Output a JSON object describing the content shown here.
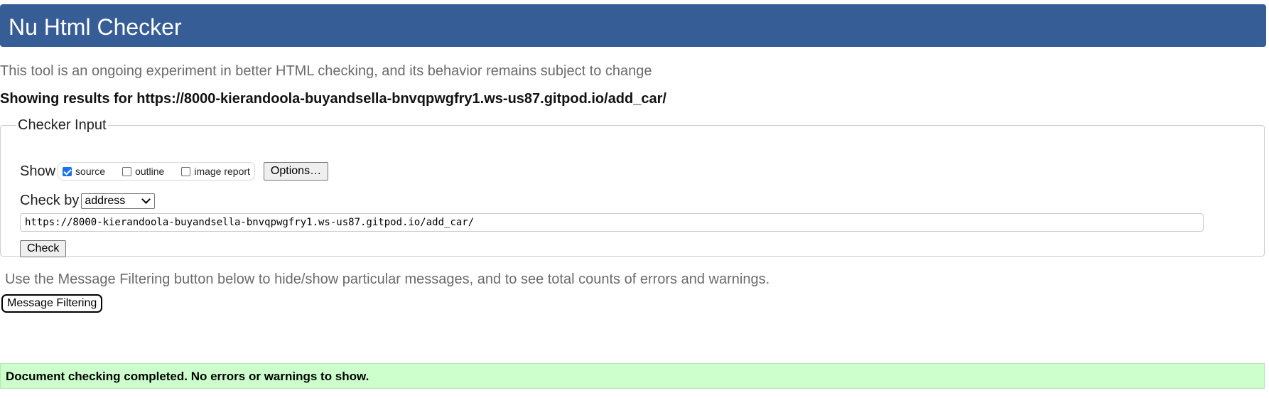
{
  "header": {
    "title": "Nu Html Checker"
  },
  "tagline": "This tool is an ongoing experiment in better HTML checking, and its behavior remains subject to change",
  "results": {
    "prefix": "Showing results for ",
    "url": "https://8000-kierandoola-buyandsella-bnvqpwgfry1.ws-us87.gitpod.io/add_car/"
  },
  "checker": {
    "legend": "Checker Input",
    "show_label": "Show",
    "show_options": [
      {
        "label": "source",
        "checked": true
      },
      {
        "label": "outline",
        "checked": false
      },
      {
        "label": "image report",
        "checked": false
      }
    ],
    "options_button": "Options…",
    "check_by_label": "Check by",
    "check_by_selected": "address",
    "url_value": "https://8000-kierandoola-buyandsella-bnvqpwgfry1.ws-us87.gitpod.io/add_car/",
    "check_button": "Check"
  },
  "filtering": {
    "hint": "Use the Message Filtering button below to hide/show particular messages, and to see total counts of errors and warnings.",
    "button": "Message Filtering"
  },
  "status": {
    "message": "Document checking completed. No errors or warnings to show."
  },
  "colors": {
    "header_bg": "#365d95",
    "success_bg": "#ccffcc",
    "muted_text": "#6b6b6b"
  },
  "icons": {
    "select_arrow": "chevron-down-icon",
    "checkbox_checked": "checkmark-icon"
  }
}
